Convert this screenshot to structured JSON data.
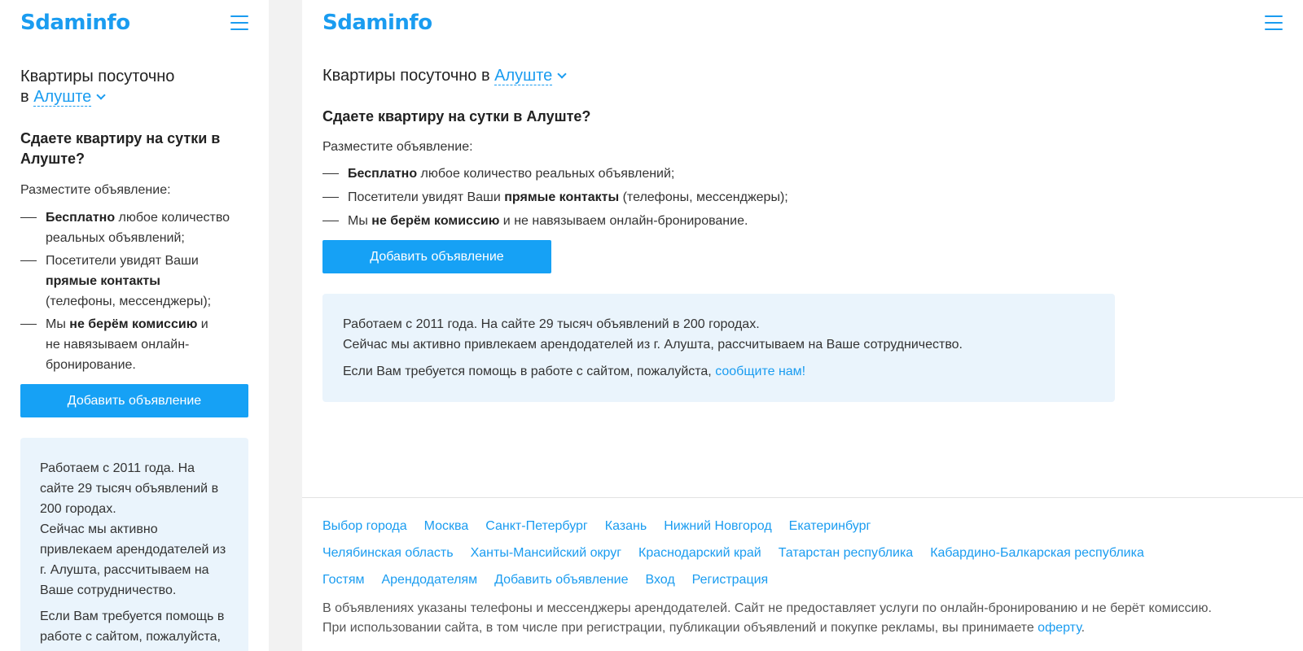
{
  "logo": "Sdaminfo",
  "title_prefix": "Квартиры посуточно в",
  "title_prefix_line1": "Квартиры посуточно",
  "title_prefix_line2": "в",
  "city": "Алуште",
  "question": "Сдаете квартиру на сутки в Алуште?",
  "question_line1": "Сдаете квартиру на сутки в",
  "question_line2": "Алуште?",
  "place_prompt": "Разместите объявление:",
  "bullets": [
    {
      "pre": "",
      "bold": "Бесплатно",
      "post": " любое количество реальных объявлений;"
    },
    {
      "pre": "Посетители увидят Ваши ",
      "bold": "прямые контакты",
      "post": " (телефоны, мессенджеры);"
    },
    {
      "pre": "Мы ",
      "bold": "не берём комиссию",
      "post": " и не навязываем онлайн-бронирование."
    }
  ],
  "mobile_bullets": [
    {
      "pre": "",
      "bold": "Бесплатно",
      "post": " любое количество реальных объявлений;"
    },
    {
      "pre": "Посетители увидят Ваши ",
      "bold": "прямые контакты",
      "post": " (телефоны, мессенджеры);"
    },
    {
      "pre": "Мы ",
      "bold": "не берём комиссию",
      "post": " и не навязываем онлайн-бронирование."
    }
  ],
  "add_button": "Добавить объявление",
  "info": {
    "line1": "Работаем с 2011 года. На сайте 29 тысяч объявлений в 200 городах.",
    "line2": "Сейчас мы активно привлекаем арендодателей из г. Алушта, рассчитываем на Ваше сотрудничество.",
    "help_text": "Если Вам требуется помощь в работе с сайтом, пожалуйста, ",
    "help_link": "сообщите нам!",
    "m_line1": "Работаем с 2011 года. На сайте 29 тысяч объявлений в 200 городах.",
    "m_line2": "Сейчас мы активно привлекаем арендодателей из г. Алушта, рассчитываем на Ваше сотрудничество.",
    "m_help": "Если Вам требуется помощь в работе с сайтом, пожалуйста,"
  },
  "footer": {
    "row1": [
      "Выбор города",
      "Москва",
      "Санкт-Петербург",
      "Казань",
      "Нижний Новгород",
      "Екатеринбург"
    ],
    "row2": [
      "Челябинская область",
      "Ханты-Мансийский округ",
      "Краснодарский край",
      "Татарстан республика",
      "Кабардино-Балкарская республика"
    ],
    "row3": [
      "Гостям",
      "Арендодателям",
      "Добавить объявление",
      "Вход",
      "Регистрация"
    ],
    "disclaimer1": "В объявлениях указаны телефоны и мессенджеры арендодателей. Сайт не предоставляет услуги по онлайн-бронированию и не берёт комиссию.",
    "disclaimer2_pre": "При использовании сайта, в том числе при регистрации, публикации объявлений и покупке рекламы, вы принимаете ",
    "disclaimer2_link": "оферту",
    "disclaimer2_post": "."
  }
}
